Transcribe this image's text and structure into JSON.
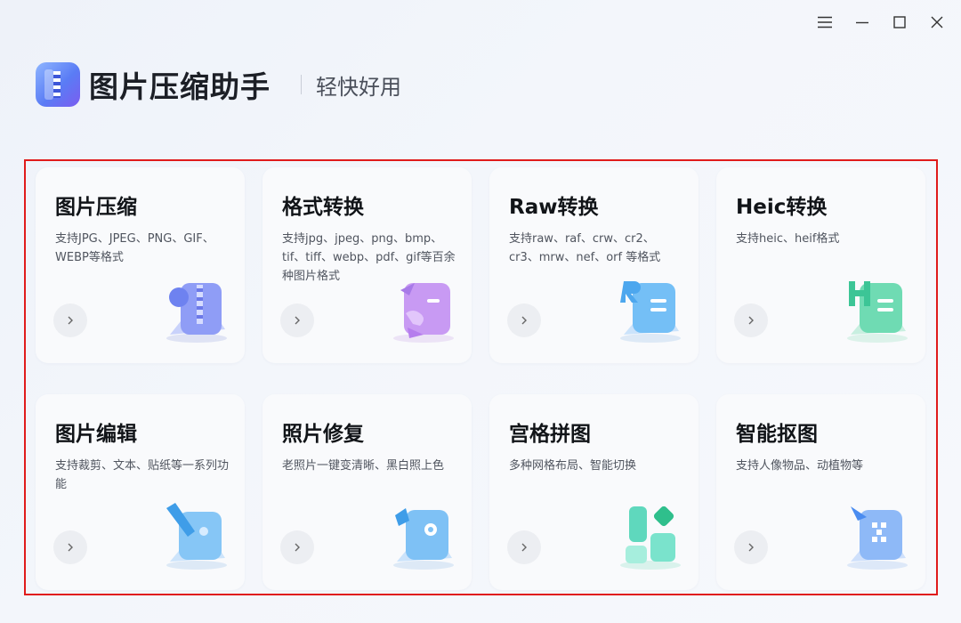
{
  "app": {
    "title": "图片压缩助手",
    "slogan": "轻快好用"
  },
  "window_controls": [
    "menu-icon",
    "minimize-icon",
    "maximize-icon",
    "close-icon"
  ],
  "colors": {
    "selection_border": "#e01b1b",
    "card_background": "#f9fafc",
    "logo_gradient": [
      "#8fb6ff",
      "#5a7cf5",
      "#7b5cf0"
    ]
  },
  "cards": [
    {
      "title": "图片压缩",
      "desc": "支持JPG、JPEG、PNG、GIF、WEBP等格式",
      "icon": "compress-image-icon",
      "color": "#7d8bf5"
    },
    {
      "title": "格式转换",
      "desc": "支持jpg、jpeg、png、bmp、tif、tiff、webp、pdf、gif等百余种图片格式",
      "icon": "convert-format-icon",
      "color": "#b678f0"
    },
    {
      "title": "Raw转换",
      "desc": "支持raw、raf、crw、cr2、cr3、mrw、nef、orf 等格式",
      "icon": "raw-convert-icon",
      "color": "#59b2f2"
    },
    {
      "title": "Heic转换",
      "desc": "支持heic、heif格式",
      "icon": "heic-convert-icon",
      "color": "#4fd6a8"
    },
    {
      "title": "图片编辑",
      "desc": "支持裁剪、文本、贴纸等一系列功能",
      "icon": "edit-image-icon",
      "color": "#5ab4f0"
    },
    {
      "title": "照片修复",
      "desc": "老照片一键变清晰、黑白照上色",
      "icon": "photo-repair-icon",
      "color": "#5aaef2"
    },
    {
      "title": "宫格拼图",
      "desc": "多种网格布局、智能切换",
      "icon": "grid-collage-icon",
      "color": "#4fd2b4"
    },
    {
      "title": "智能抠图",
      "desc": "支持人像物品、动植物等",
      "icon": "smart-cutout-icon",
      "color": "#6aa8f5"
    }
  ]
}
